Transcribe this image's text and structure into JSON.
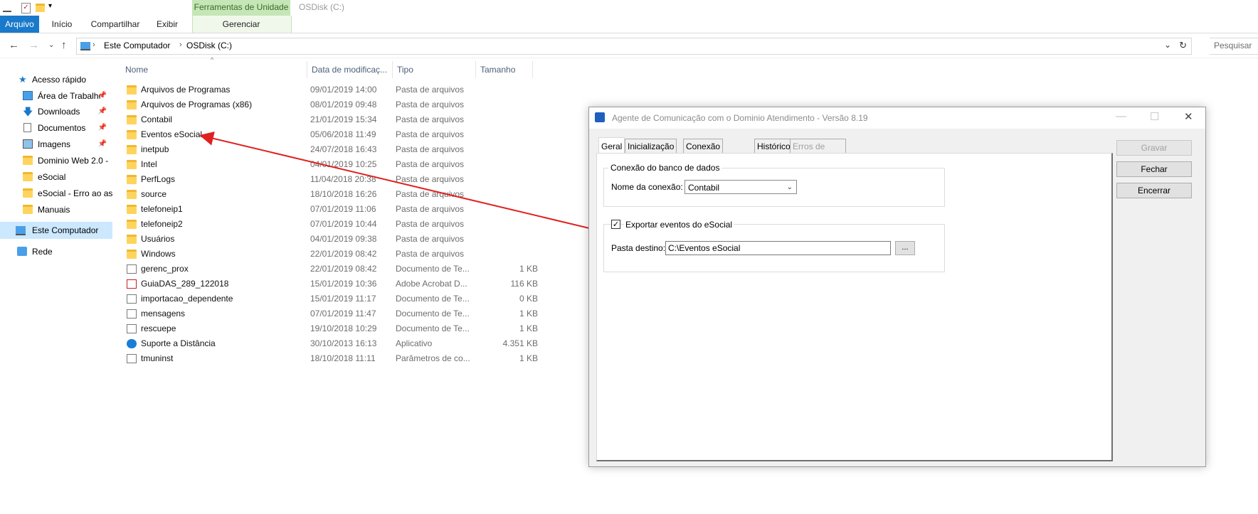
{
  "explorer": {
    "ribbon": {
      "tabs": [
        "Arquivo",
        "Início",
        "Compartilhar",
        "Exibir",
        "Gerenciar"
      ],
      "contextual_group": "Ferramentas de Unidade",
      "window_title": "OSDisk (C:)"
    },
    "address": {
      "breadcrumb": [
        "Este Computador",
        "OSDisk (C:)"
      ],
      "search_placeholder": "Pesquisar"
    },
    "nav": [
      {
        "label": "Acesso rápido",
        "icon": "star-icon",
        "pinned": false
      },
      {
        "label": "Área de Trabalho",
        "icon": "desktop-icon",
        "pinned": true
      },
      {
        "label": "Downloads",
        "icon": "download-icon",
        "pinned": true
      },
      {
        "label": "Documentos",
        "icon": "documents-icon",
        "pinned": true
      },
      {
        "label": "Imagens",
        "icon": "pictures-icon",
        "pinned": true
      },
      {
        "label": "Dominio Web 2.0 -",
        "icon": "folder-icon",
        "pinned": false
      },
      {
        "label": "eSocial",
        "icon": "folder-icon",
        "pinned": false
      },
      {
        "label": "eSocial - Erro ao ass",
        "icon": "folder-icon",
        "pinned": false
      },
      {
        "label": "Manuais",
        "icon": "folder-icon",
        "pinned": false
      },
      {
        "label": "Este Computador",
        "icon": "computer-icon",
        "pinned": false
      },
      {
        "label": "Rede",
        "icon": "network-icon",
        "pinned": false
      }
    ],
    "columns": [
      "Nome",
      "Data de modificaç...",
      "Tipo",
      "Tamanho"
    ],
    "files": [
      {
        "name": "Arquivos de Programas",
        "date": "09/01/2019 14:00",
        "type": "Pasta de arquivos",
        "size": "",
        "icon": "folder-icon"
      },
      {
        "name": "Arquivos de Programas (x86)",
        "date": "08/01/2019 09:48",
        "type": "Pasta de arquivos",
        "size": "",
        "icon": "folder-icon"
      },
      {
        "name": "Contabil",
        "date": "21/01/2019 15:34",
        "type": "Pasta de arquivos",
        "size": "",
        "icon": "folder-icon"
      },
      {
        "name": "Eventos eSocial",
        "date": "05/06/2018 11:49",
        "type": "Pasta de arquivos",
        "size": "",
        "icon": "folder-icon"
      },
      {
        "name": "inetpub",
        "date": "24/07/2018 16:43",
        "type": "Pasta de arquivos",
        "size": "",
        "icon": "folder-icon"
      },
      {
        "name": "Intel",
        "date": "04/01/2019 10:25",
        "type": "Pasta de arquivos",
        "size": "",
        "icon": "folder-icon"
      },
      {
        "name": "PerfLogs",
        "date": "11/04/2018 20:38",
        "type": "Pasta de arquivos",
        "size": "",
        "icon": "folder-icon"
      },
      {
        "name": "source",
        "date": "18/10/2018 16:26",
        "type": "Pasta de arquivos",
        "size": "",
        "icon": "folder-icon"
      },
      {
        "name": "telefoneip1",
        "date": "07/01/2019 11:06",
        "type": "Pasta de arquivos",
        "size": "",
        "icon": "folder-icon"
      },
      {
        "name": "telefoneip2",
        "date": "07/01/2019 10:44",
        "type": "Pasta de arquivos",
        "size": "",
        "icon": "folder-icon"
      },
      {
        "name": "Usuários",
        "date": "04/01/2019 09:38",
        "type": "Pasta de arquivos",
        "size": "",
        "icon": "folder-icon"
      },
      {
        "name": "Windows",
        "date": "22/01/2019 08:42",
        "type": "Pasta de arquivos",
        "size": "",
        "icon": "folder-icon"
      },
      {
        "name": "gerenc_prox",
        "date": "22/01/2019 08:42",
        "type": "Documento de Te...",
        "size": "1 KB",
        "icon": "text-file-icon"
      },
      {
        "name": "GuiaDAS_289_122018",
        "date": "15/01/2019 10:36",
        "type": "Adobe Acrobat D...",
        "size": "116 KB",
        "icon": "pdf-icon"
      },
      {
        "name": "importacao_dependente",
        "date": "15/01/2019 11:17",
        "type": "Documento de Te...",
        "size": "0 KB",
        "icon": "text-file-icon"
      },
      {
        "name": "mensagens",
        "date": "07/01/2019 11:47",
        "type": "Documento de Te...",
        "size": "1 KB",
        "icon": "text-file-icon"
      },
      {
        "name": "rescuepe",
        "date": "19/10/2018 10:29",
        "type": "Documento de Te...",
        "size": "1 KB",
        "icon": "text-file-icon"
      },
      {
        "name": "Suporte a Distância",
        "date": "30/10/2013 16:13",
        "type": "Aplicativo",
        "size": "4.351 KB",
        "icon": "teamviewer-icon"
      },
      {
        "name": "tmuninst",
        "date": "18/10/2018 11:11",
        "type": "Parâmetros de co...",
        "size": "1 KB",
        "icon": "settings-file-icon"
      }
    ]
  },
  "dialog": {
    "title": "Agente de Comunicação com o Dominio Atendimento - Versão 8.19",
    "tabs": [
      "Geral",
      "Inicialização",
      "Conexão internet",
      "Histórico",
      "Erros de comunicação"
    ],
    "group_db": "Conexão do banco de dados",
    "conn_label": "Nome da conexão:",
    "conn_value": "Contabil",
    "export_label": "Exportar eventos do eSocial",
    "export_checked": true,
    "dest_label": "Pasta destino:",
    "dest_value": "C:\\Eventos eSocial",
    "browse_label": "...",
    "buttons": {
      "save": "Gravar",
      "close": "Fechar",
      "exit": "Encerrar"
    }
  },
  "colors": {
    "accent": "#1979ca",
    "arrow": "#e02020",
    "context_tab": "#c5e6b6"
  }
}
